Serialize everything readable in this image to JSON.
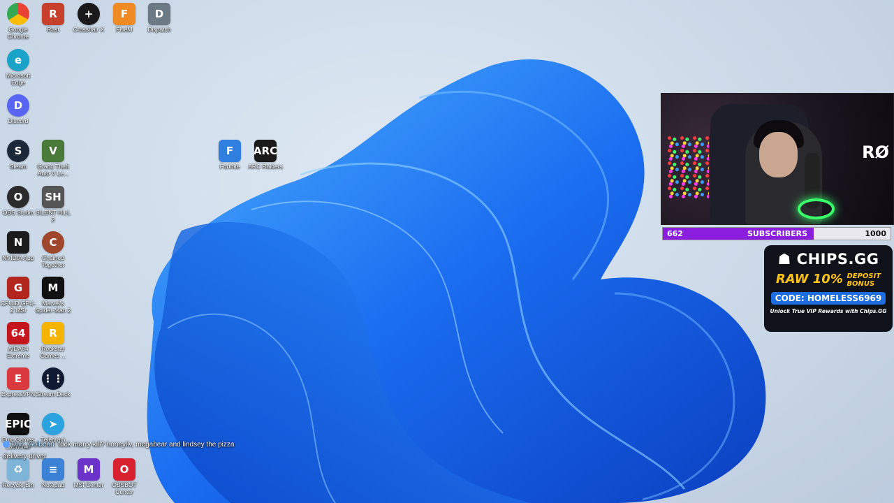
{
  "desktop": {
    "icons": [
      {
        "label": "Google Chrome",
        "glyph": "",
        "color": "#e94235"
      },
      {
        "label": "Rust",
        "glyph": "R",
        "color": "#c7402b"
      },
      {
        "label": "Crosshair X",
        "glyph": "+",
        "color": "#1a1a1a"
      },
      {
        "label": "FiveM",
        "glyph": "F",
        "color": "#f08a24"
      },
      {
        "label": "Dispatch",
        "glyph": "D",
        "color": "#6c7a86"
      },
      {
        "label": "Microsoft Edge",
        "glyph": "e",
        "color": "#1aa3c8"
      },
      {
        "label": "Discord",
        "glyph": "D",
        "color": "#5865f2"
      },
      {
        "label": "Steam",
        "glyph": "S",
        "color": "#1b2838"
      },
      {
        "label": "Grand Theft Auto V Le...",
        "glyph": "V",
        "color": "#4a7a3a"
      },
      {
        "label": "Fortnite",
        "glyph": "F",
        "color": "#2f7fe0"
      },
      {
        "label": "ARC Raiders",
        "glyph": "ARC",
        "color": "#1a1a1a"
      },
      {
        "label": "OBS Studio",
        "glyph": "O",
        "color": "#2b2b2b"
      },
      {
        "label": "SILENT HILL 2",
        "glyph": "SH",
        "color": "#555555"
      },
      {
        "label": "NVIDIA App",
        "glyph": "N",
        "color": "#1b1b1b"
      },
      {
        "label": "Chained Together",
        "glyph": "C",
        "color": "#a0462c"
      },
      {
        "label": "CPUID GPU-Z MSI",
        "glyph": "G",
        "color": "#b3261e"
      },
      {
        "label": "Marvel's Spider-Man 2",
        "glyph": "M",
        "color": "#111111"
      },
      {
        "label": "AIDA64 Extreme",
        "glyph": "64",
        "color": "#c4161c"
      },
      {
        "label": "Rockstar Games ...",
        "glyph": "R",
        "color": "#f4b400"
      },
      {
        "label": "ExpressVPN",
        "glyph": "E",
        "color": "#da3940"
      },
      {
        "label": "Stream Deck",
        "glyph": "⋮⋮",
        "color": "#111a33"
      },
      {
        "label": "Epic Games Launcher",
        "glyph": "EPIC",
        "color": "#111111"
      },
      {
        "label": "Telegram",
        "glyph": "➤",
        "color": "#2aa3e0"
      },
      {
        "label": "Recycle Bin",
        "glyph": "♻",
        "color": "#7fb4d9"
      },
      {
        "label": "Notepad",
        "glyph": "≡",
        "color": "#3b82d6"
      },
      {
        "label": "MSI Center",
        "glyph": "M",
        "color": "#6b33c9"
      },
      {
        "label": "OBSBOT Center",
        "glyph": "O",
        "color": "#d8202f"
      }
    ]
  },
  "overlay": {
    "subscribers": {
      "current": "662",
      "label": "SUBSCRIBERS",
      "goal": "1000",
      "progress": 0.662,
      "color": "#8a1dde"
    },
    "promo": {
      "brand": "CHIPS.GG",
      "offer_big": "RAW 10%",
      "offer_small_1": "DEPOSIT",
      "offer_small_2": "BONUS",
      "code": "CODE: HOMELESS6969",
      "unlock": "Unlock True VIP Rewards with Chips.GG"
    },
    "webcam_brand": "RØ",
    "chat": {
      "user": "Dan_Golbean",
      "message": ": fuck marry kill? honeyliv, megabear and lindsey the pizza",
      "continuation": "delivery driver"
    }
  }
}
